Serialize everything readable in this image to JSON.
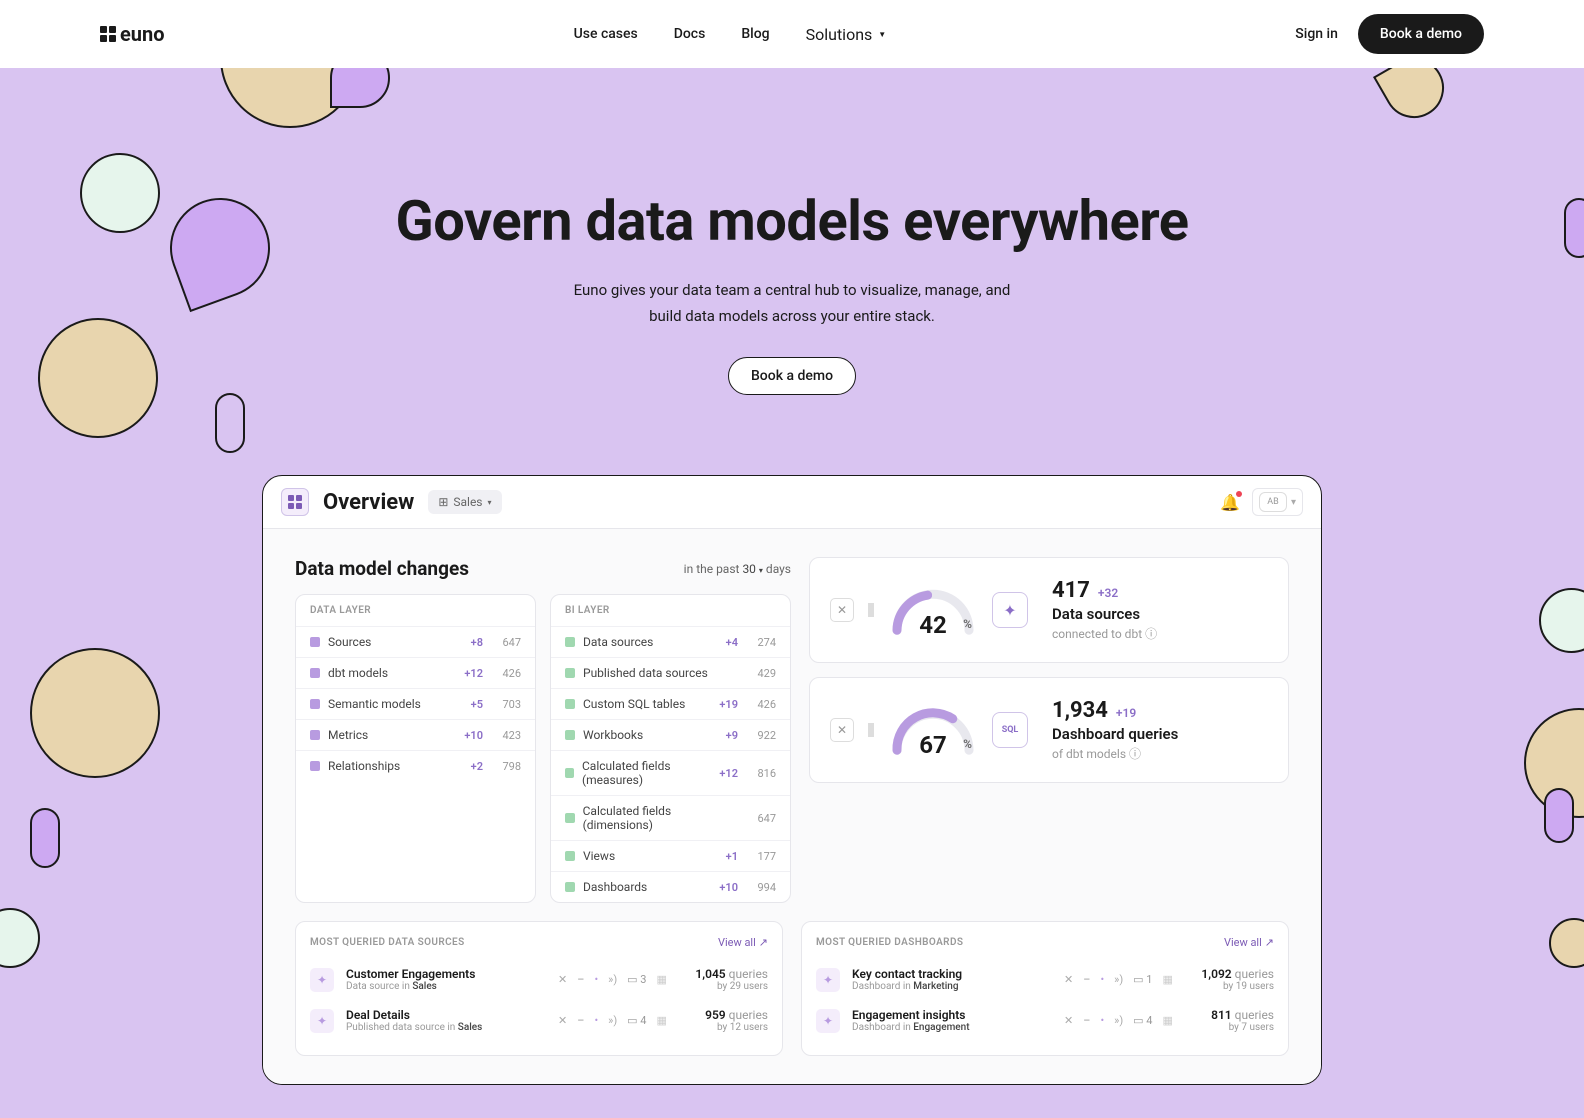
{
  "header": {
    "logo_text": "euno",
    "nav": {
      "use_cases": "Use cases",
      "docs": "Docs",
      "blog": "Blog",
      "solutions": "Solutions"
    },
    "sign_in": "Sign in",
    "book_demo": "Book a demo"
  },
  "hero": {
    "title": "Govern data models everywhere",
    "subtitle_line1": "Euno gives your data team a central hub to visualize, manage, and",
    "subtitle_line2": "build data models across your entire stack.",
    "cta": "Book a demo"
  },
  "app": {
    "title": "Overview",
    "filter": "Sales",
    "avatar": "AB",
    "changes": {
      "title": "Data model changes",
      "timespan_prefix": "in the past",
      "timespan_value": "30",
      "timespan_suffix": "days",
      "data_layer_title": "DATA LAYER",
      "data_layer": [
        {
          "name": "Sources",
          "delta": "+8",
          "count": "647"
        },
        {
          "name": "dbt models",
          "delta": "+12",
          "count": "426"
        },
        {
          "name": "Semantic models",
          "delta": "+5",
          "count": "703"
        },
        {
          "name": "Metrics",
          "delta": "+10",
          "count": "423"
        },
        {
          "name": "Relationships",
          "delta": "+2",
          "count": "798"
        }
      ],
      "bi_layer_title": "BI LAYER",
      "bi_layer": [
        {
          "name": "Data sources",
          "delta": "+4",
          "count": "274"
        },
        {
          "name": "Published data sources",
          "delta": "",
          "count": "429"
        },
        {
          "name": "Custom SQL tables",
          "delta": "+19",
          "count": "426"
        },
        {
          "name": "Workbooks",
          "delta": "+9",
          "count": "922"
        },
        {
          "name": "Calculated fields (measures)",
          "delta": "+12",
          "count": "816"
        },
        {
          "name": "Calculated fields (dimensions)",
          "delta": "",
          "count": "647"
        },
        {
          "name": "Views",
          "delta": "+1",
          "count": "177"
        },
        {
          "name": "Dashboards",
          "delta": "+10",
          "count": "994"
        }
      ]
    },
    "stats": [
      {
        "pct": "42",
        "num": "417",
        "delta": "+32",
        "title": "Data sources",
        "sub": "connected to dbt"
      },
      {
        "pct": "67",
        "num": "1,934",
        "delta": "+19",
        "title": "Dashboard queries",
        "sub": "of dbt models"
      }
    ],
    "queries": {
      "ds_title": "MOST QUERIED DATA SOURCES",
      "db_title": "MOST QUERIED DASHBOARDS",
      "view_all": "View all",
      "ds": [
        {
          "name": "Customer Engagements",
          "type": "Data source",
          "scope": "Sales",
          "badge": "3",
          "num": "1,045",
          "unit": "queries",
          "by": "by 29 users"
        },
        {
          "name": "Deal Details",
          "type": "Published data source",
          "scope": "Sales",
          "badge": "4",
          "num": "959",
          "unit": "queries",
          "by": "by 12 users"
        }
      ],
      "db": [
        {
          "name": "Key contact tracking",
          "type": "Dashboard",
          "scope": "Marketing",
          "badge": "1",
          "num": "1,092",
          "unit": "queries",
          "by": "by 19 users"
        },
        {
          "name": "Engagement insights",
          "type": "Dashboard",
          "scope": "Engagement",
          "badge": "4",
          "num": "811",
          "unit": "queries",
          "by": "by 7 users"
        }
      ]
    }
  }
}
